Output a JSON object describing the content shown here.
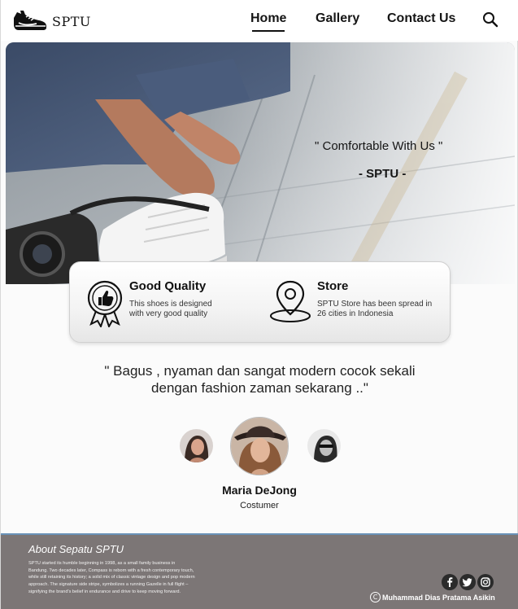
{
  "brand": {
    "name": "SPTU",
    "logo_icon": "sneaker-icon"
  },
  "nav": {
    "items": [
      {
        "label": "Home",
        "active": true
      },
      {
        "label": "Gallery",
        "active": false
      },
      {
        "label": "Contact Us",
        "active": false
      }
    ],
    "search_icon": "search-icon"
  },
  "hero": {
    "quote": "\" Comfortable With Us \"",
    "brand_line": "- SPTU -"
  },
  "features": [
    {
      "icon": "quality-badge-icon",
      "title": "Good Quality",
      "description": [
        "This shoes is designed",
        "with very good quality"
      ]
    },
    {
      "icon": "location-pin-icon",
      "title": "Store",
      "description": [
        "SPTU Store has been spread in",
        "26 cities in Indonesia"
      ]
    }
  ],
  "testimonial": {
    "quote_line1": "\" Bagus , nyaman dan sangat modern cocok sekali",
    "quote_line2": "dengan fashion zaman sekarang ..\"",
    "name": "Maria DeJong",
    "role": "Costumer"
  },
  "footer": {
    "title": "About Sepatu SPTU",
    "text": "SPTU started its humble beginning in 1998, as a small family business in Bandung. Two decades later, Compass is reborn with a fresh contemporary touch, while still retaining its history; a solid mix of classic vintage design and pop modern approach. The signature side stripe, symbolizes a running Gazelle in full flight – signifying the brand's belief in endurance and drive to keep moving forward.",
    "social_icons": [
      "facebook-icon",
      "twitter-icon",
      "instagram-icon"
    ],
    "copyright_symbol": "C",
    "copyright": "Muhammad Dias Pratama Asikin"
  }
}
